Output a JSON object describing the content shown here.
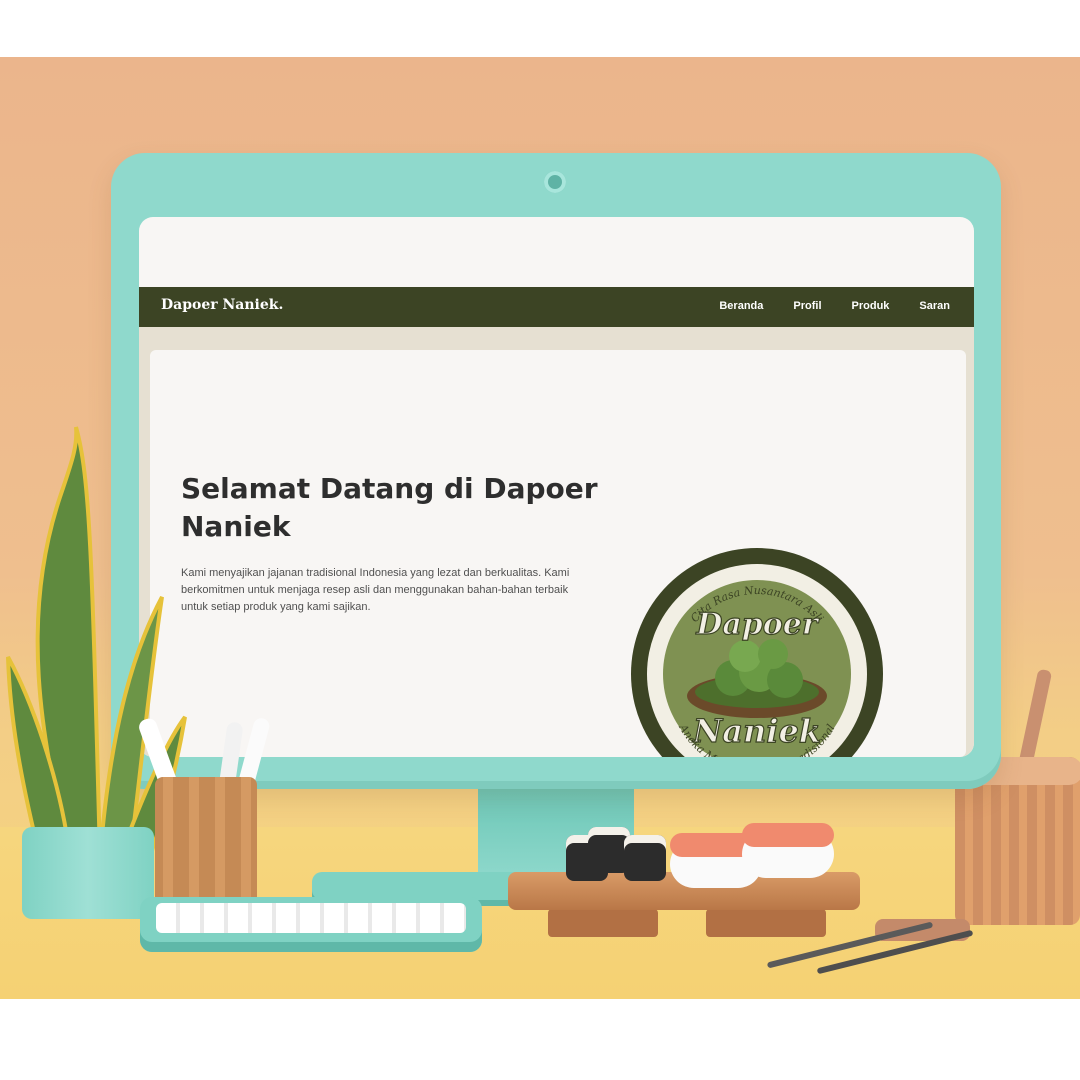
{
  "site": {
    "brand": "Dapoer Naniek.",
    "nav": [
      {
        "label": "Beranda"
      },
      {
        "label": "Profil"
      },
      {
        "label": "Produk"
      },
      {
        "label": "Saran"
      }
    ]
  },
  "hero": {
    "title": "Selamat Datang di Dapoer Naniek",
    "description": "Kami menyajikan jajanan tradisional Indonesia yang lezat dan berkualitas. Kami berkomitmen untuk menjaga resep asli dan menggunakan bahan-bahan terbaik untuk setiap produk yang kami sajikan."
  },
  "logo": {
    "top_arc": "Cita Rasa Nusantara Asli",
    "word1": "Dapoer",
    "word2": "Naniek",
    "bottom_arc": "Aneka Macam Jajanan Tradisional",
    "colors": {
      "outer": "#3c4424",
      "ring": "#7f9152",
      "inner": "#f2efe4",
      "leaf": "#5a8a3a"
    }
  },
  "theme": {
    "navbar": "#3c4424",
    "monitor": "#8fd9cc",
    "background": "#ebb58c"
  }
}
